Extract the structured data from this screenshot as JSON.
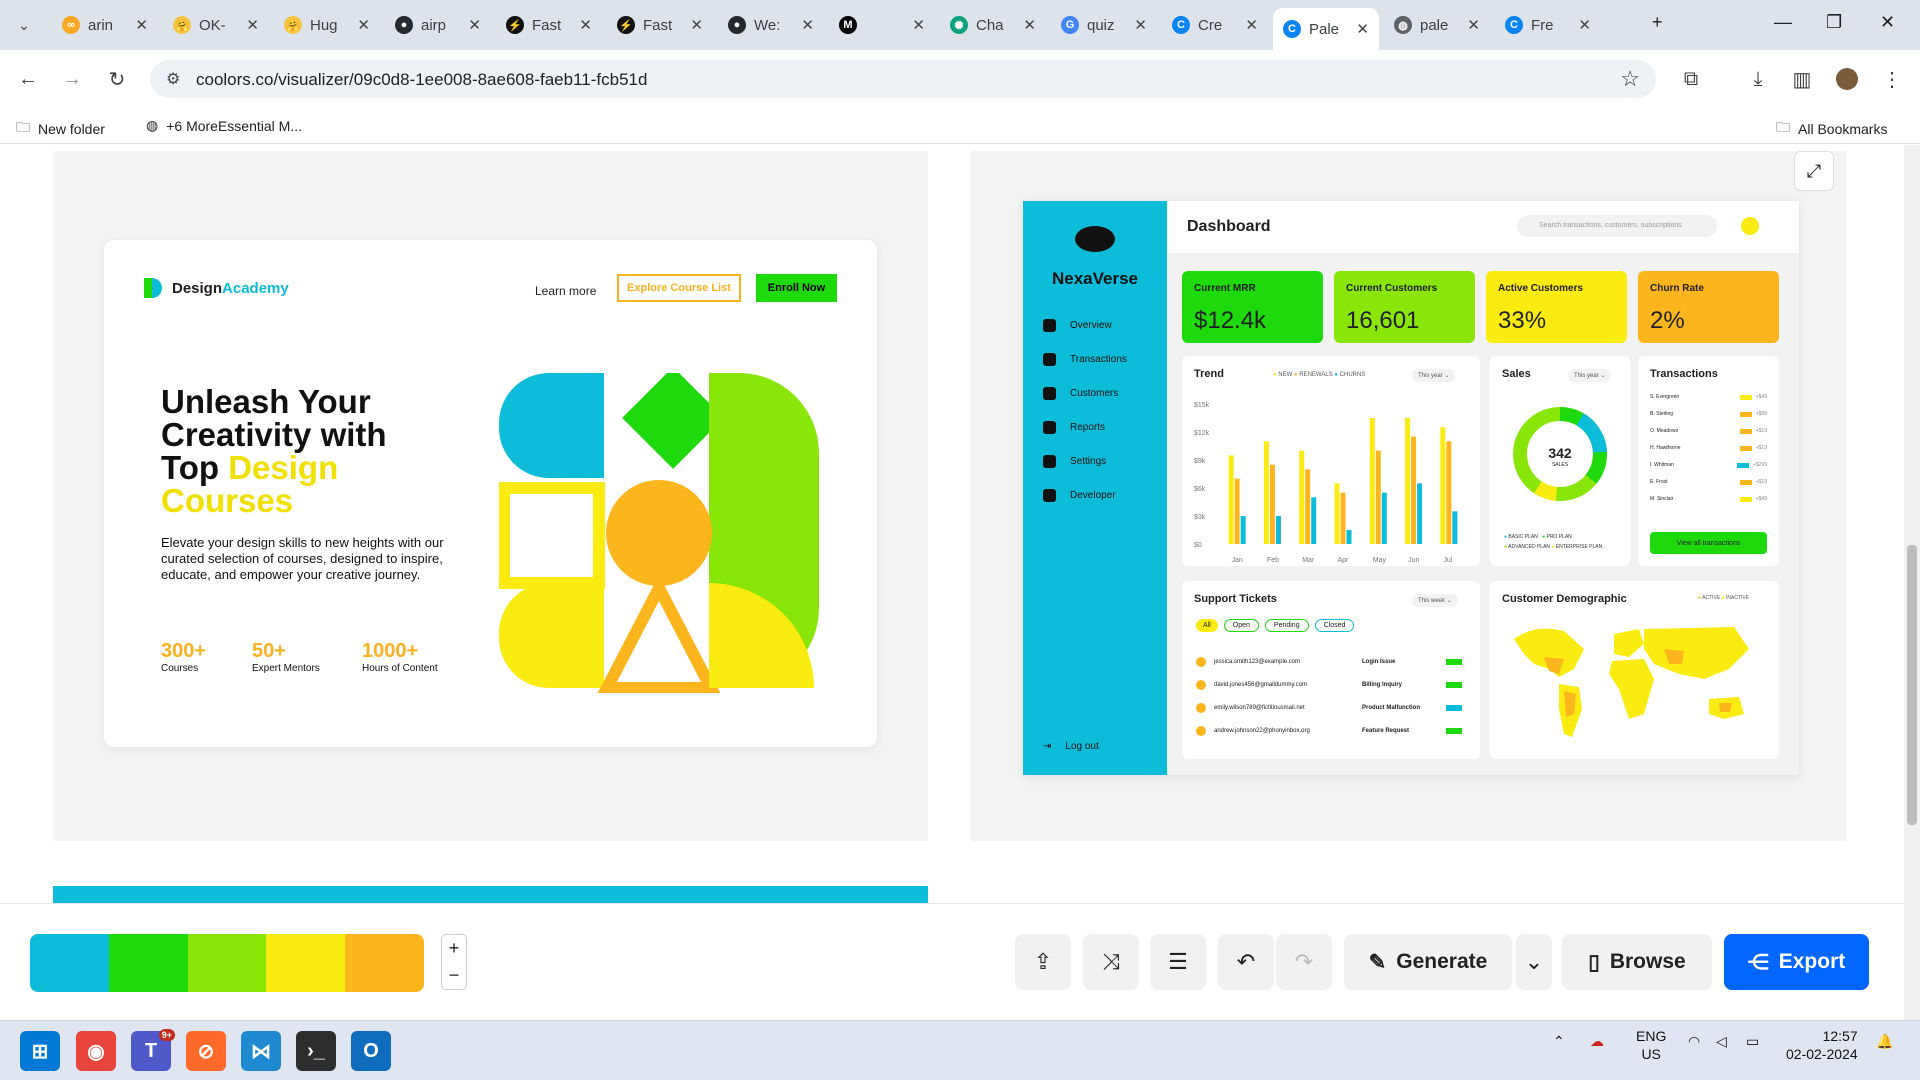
{
  "browser": {
    "tabs": [
      {
        "title": "arin",
        "fav": "∞"
      },
      {
        "title": "OK-",
        "fav": "🤗"
      },
      {
        "title": "Hug",
        "fav": "🤗"
      },
      {
        "title": "airp",
        "fav": "●"
      },
      {
        "title": "Fast",
        "fav": "⚡"
      },
      {
        "title": "Fast",
        "fav": "⚡"
      },
      {
        "title": "We:",
        "fav": "●"
      },
      {
        "title": "",
        "fav": "M"
      },
      {
        "title": "Cha",
        "fav": "✺"
      },
      {
        "title": "quiz",
        "fav": "G"
      },
      {
        "title": "Cre",
        "fav": "C"
      },
      {
        "title": "Pale",
        "fav": "C"
      },
      {
        "title": "pale",
        "fav": "◍"
      },
      {
        "title": "Fre",
        "fav": "C"
      }
    ],
    "url": "coolors.co/visualizer/09c0d8-1ee008-8ae608-faeb11-fcb51d",
    "bookmarks": [
      {
        "label": "New folder"
      },
      {
        "label": "+6 MoreEssential M..."
      },
      {
        "label": "All Bookmarks"
      }
    ]
  },
  "left_preview": {
    "logo": {
      "part1": "Design",
      "part2": "Academy"
    },
    "nav": {
      "learn_more": "Learn more",
      "explore": "Explore Course List",
      "enroll": "Enroll Now"
    },
    "hero": {
      "line1": "Unleash Your",
      "line2": "Creativity with",
      "line3a": "Top ",
      "line3b": "Design",
      "line4": "Courses"
    },
    "description": "Elevate your design skills to new heights with our curated selection of courses, designed to inspire, educate, and empower your creative journey.",
    "stats": [
      {
        "value": "300+",
        "label": "Courses"
      },
      {
        "value": "50+",
        "label": "Expert Mentors"
      },
      {
        "value": "1000+",
        "label": "Hours of Content"
      }
    ]
  },
  "right_preview": {
    "brand": "NexaVerse",
    "menu": [
      "Overview",
      "Transactions",
      "Customers",
      "Reports",
      "Settings",
      "Developer"
    ],
    "logout": "Log out",
    "title": "Dashboard",
    "search_placeholder": "Search transactions, customers, subscriptions",
    "kpis": [
      {
        "title": "Current MRR",
        "value": "$12.4k",
        "color": "#1ed90c"
      },
      {
        "title": "Current Customers",
        "value": "16,601",
        "color": "#8ae608"
      },
      {
        "title": "Active Customers",
        "value": "33%",
        "color": "#faeb11"
      },
      {
        "title": "Churn Rate",
        "value": "2%",
        "color": "#fcb51d"
      }
    ],
    "trend": {
      "title": "Trend",
      "legend": [
        "NEW",
        "RENEWALS",
        "CHURNS"
      ],
      "period": "This year",
      "yticks": [
        "$15k",
        "$12k",
        "$9k",
        "$6k",
        "$3k",
        "$0"
      ],
      "months": [
        "Jan",
        "Feb",
        "Mar",
        "Apr",
        "May",
        "Jun",
        "Jul"
      ],
      "chart_data": {
        "type": "bar",
        "categories": [
          "Jan",
          "Feb",
          "Mar",
          "Apr",
          "May",
          "Jun",
          "Jul"
        ],
        "ylim": [
          0,
          15
        ],
        "series": [
          {
            "name": "NEW",
            "values": [
              9.5,
              11,
              10,
              6.5,
              13.5,
              13.5,
              12.5
            ],
            "color": "#faeb11"
          },
          {
            "name": "RENEWALS",
            "values": [
              7,
              8.5,
              8,
              5.5,
              10,
              11.5,
              11
            ],
            "color": "#fcb51d"
          },
          {
            "name": "CHURNS",
            "values": [
              3,
              3,
              5,
              1.5,
              5.5,
              6.5,
              3.5
            ],
            "color": "#0cbcd8"
          }
        ]
      }
    },
    "sales": {
      "title": "Sales",
      "period": "This year",
      "value": "342",
      "unit": "SALES",
      "legend": [
        "BASIC PLAN",
        "PRO PLAN",
        "ADVANCED PLAN",
        "ENTERPRISE PLAN"
      ]
    },
    "transactions": {
      "title": "Transactions",
      "rows": [
        "S. Evergreen",
        "B. Sterling",
        "O. Meadows",
        "H. Hawthorne",
        "I. Whitman",
        "E. Frost",
        "M. Sinclair"
      ],
      "amounts": [
        "+$49",
        "+$99",
        "+$19",
        "+$19",
        "+$299",
        "+$19",
        "+$49"
      ],
      "button": "View all transactions"
    },
    "tickets": {
      "title": "Support Tickets",
      "period": "This week",
      "filters": [
        "All",
        "Open",
        "Pending",
        "Closed"
      ],
      "rows": [
        {
          "email": "jessica.smith123@example.com",
          "issue": "Login Issue"
        },
        {
          "email": "david.jones456@gmaildummy.com",
          "issue": "Billing Inquiry"
        },
        {
          "email": "emily.wilson789@fictitiousmail.net",
          "issue": "Product Malfunction"
        },
        {
          "email": "andrew.johnson22@phonyinbox.org",
          "issue": "Feature Request"
        }
      ]
    },
    "demographic": {
      "title": "Customer Demographic",
      "legend": [
        "ACTIVE",
        "INACTIVE"
      ]
    }
  },
  "palette": [
    "#0cbcd8",
    "#1ed90c",
    "#8ae608",
    "#faeb11",
    "#fcb51d"
  ],
  "actions": {
    "generate": "Generate",
    "browse": "Browse",
    "export": "Export"
  },
  "system": {
    "lang1": "ENG",
    "lang2": "US",
    "time": "12:57",
    "date": "02-02-2024",
    "teams_badge": "9+"
  }
}
